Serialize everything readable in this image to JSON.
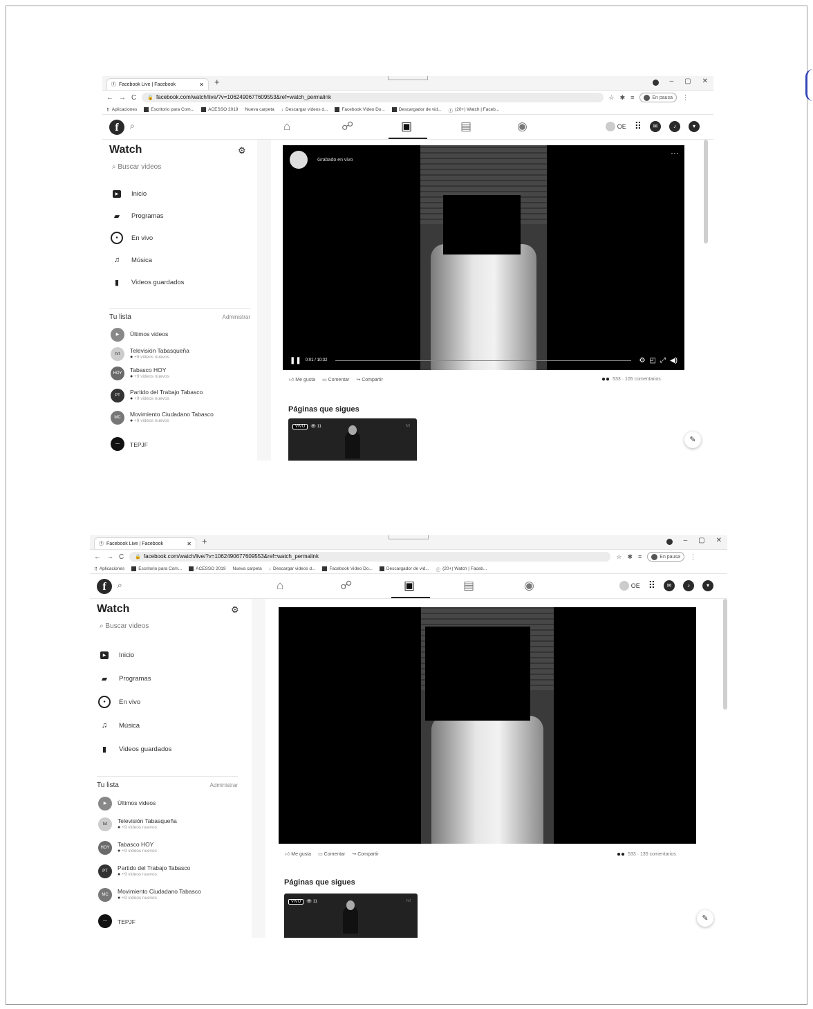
{
  "browser": {
    "tab_title": "Facebook Live | Facebook",
    "tab_close": "✕",
    "url_shot1": "facebook.com/watch/live/?v=1062490677609553&ref=watch_permalink",
    "url_shot2": "facebook.com/watch/live/?v=1062490677609553&ref=watch_permalink",
    "paused_label": "En pausa",
    "bookmarks": [
      "Aplicaciones",
      "Escritorio para Com...",
      "ACESSO 2019",
      "Nueva carpeta",
      "Descargar videos d...",
      "Facebook Video Do...",
      "Descargador de vid...",
      "(20+) Watch | Faceb..."
    ]
  },
  "facebook": {
    "user_initials": "OE",
    "nav_icons": [
      "home-icon",
      "friends-icon",
      "watch-icon",
      "marketplace-icon",
      "groups-icon"
    ]
  },
  "sidebar": {
    "title": "Watch",
    "search_placeholder": "Buscar videos",
    "items": [
      {
        "label": "Inicio",
        "icon": "play-icon"
      },
      {
        "label": "Programas",
        "icon": "shows-icon"
      },
      {
        "label": "En vivo",
        "icon": "live-icon"
      },
      {
        "label": "Música",
        "icon": "music-icon"
      },
      {
        "label": "Videos guardados",
        "icon": "bookmark-icon"
      }
    ],
    "list_heading": "Tu lista",
    "list_admin": "Administrar",
    "subscriptions": [
      {
        "name": "Últimos videos",
        "meta": ""
      },
      {
        "name": "Televisión Tabasqueña",
        "meta": "+9 videos nuevos"
      },
      {
        "name": "Tabasco HOY",
        "meta": "+9 videos nuevos"
      },
      {
        "name": "Partido del Trabajo Tabasco",
        "meta": "+9 videos nuevos"
      },
      {
        "name": "Movimiento Ciudadano Tabasco",
        "meta": "+9 videos nuevos"
      },
      {
        "name": "TEPJF",
        "meta": ""
      }
    ]
  },
  "video": {
    "recorded_label": "Grabado en vivo",
    "time": "0:01 / 10:32",
    "like": "Me gusta",
    "comment": "Comentar",
    "share": "Compartir",
    "reactions_shot1": "533 · 105 comentarios",
    "reactions_shot2": "533 · 135 comentarios"
  },
  "following": {
    "heading": "Páginas que sigues",
    "live_badge": "VIVO",
    "viewers": "11",
    "channel_logo": "tvt"
  }
}
